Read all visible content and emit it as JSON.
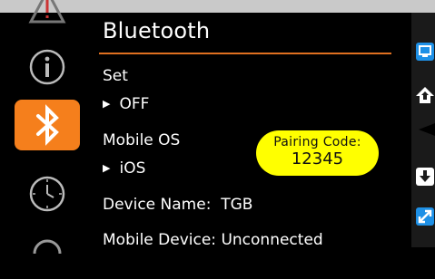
{
  "settings": {
    "title": "Bluetooth",
    "set": {
      "label": "Set",
      "value": "OFF"
    },
    "mobile_os": {
      "label": "Mobile OS",
      "value": "iOS"
    },
    "pairing": {
      "label": "Pairing Code:",
      "code": "12345"
    },
    "device_name": {
      "label": "Device Name:",
      "value": "TGB"
    },
    "mobile_device": {
      "label": "Mobile Device:",
      "value": "Unconnected"
    }
  },
  "sidebar": {
    "items": [
      {
        "icon": "warning-icon",
        "active": false
      },
      {
        "icon": "info-icon",
        "active": false
      },
      {
        "icon": "bluetooth-icon",
        "active": true
      },
      {
        "icon": "clock-icon",
        "active": false
      },
      {
        "icon": "refresh-icon",
        "active": false
      }
    ]
  },
  "rightbar": {
    "icons": [
      "screen-icon",
      "home-up-icon",
      "back-arrow-icon",
      "down-icon",
      "expand-icon"
    ]
  },
  "colors": {
    "accent": "#f57f1c",
    "pairing_bg": "#ffff00",
    "rule": "#e07020",
    "topbar": "#c9c9c9",
    "rightbar_icon": "#1e90e6"
  }
}
